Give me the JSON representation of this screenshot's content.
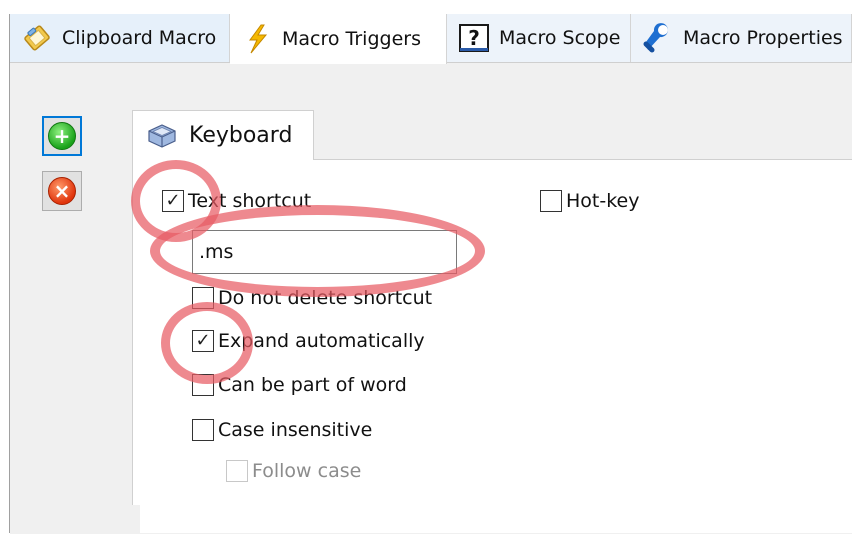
{
  "tabs": [
    {
      "label": "Clipboard Macro",
      "icon": "clipboard-icon"
    },
    {
      "label": "Macro Triggers",
      "icon": "lightning-icon"
    },
    {
      "label": "Macro Scope",
      "icon": "question-icon"
    },
    {
      "label": "Macro Properties",
      "icon": "wrench-icon"
    }
  ],
  "active_tab": "Macro Triggers",
  "side_buttons": {
    "add_icon": "plus-icon",
    "delete_icon": "x-icon"
  },
  "inner_tab": {
    "label": "Keyboard",
    "icon": "keyboard-key-icon"
  },
  "options": {
    "text_shortcut": {
      "label": "Text shortcut",
      "checked": true
    },
    "hot_key": {
      "label": "Hot-key",
      "checked": false
    },
    "shortcut_value": ".ms",
    "do_not_delete": {
      "label": "Do not delete shortcut",
      "checked": false
    },
    "expand_auto": {
      "label": "Expand automatically",
      "checked": true
    },
    "part_of_word": {
      "label": "Can be part of word",
      "checked": false
    },
    "case_insensitive": {
      "label": "Case insensitive",
      "checked": false
    },
    "follow_case": {
      "label": "Follow case",
      "checked": false,
      "disabled": true
    }
  },
  "checkmark": "✓",
  "colors": {
    "highlight": "#e85c64",
    "tab_active": "#ffffff",
    "tab_inactive": "#e6f0fa",
    "focus": "#0078d7"
  }
}
